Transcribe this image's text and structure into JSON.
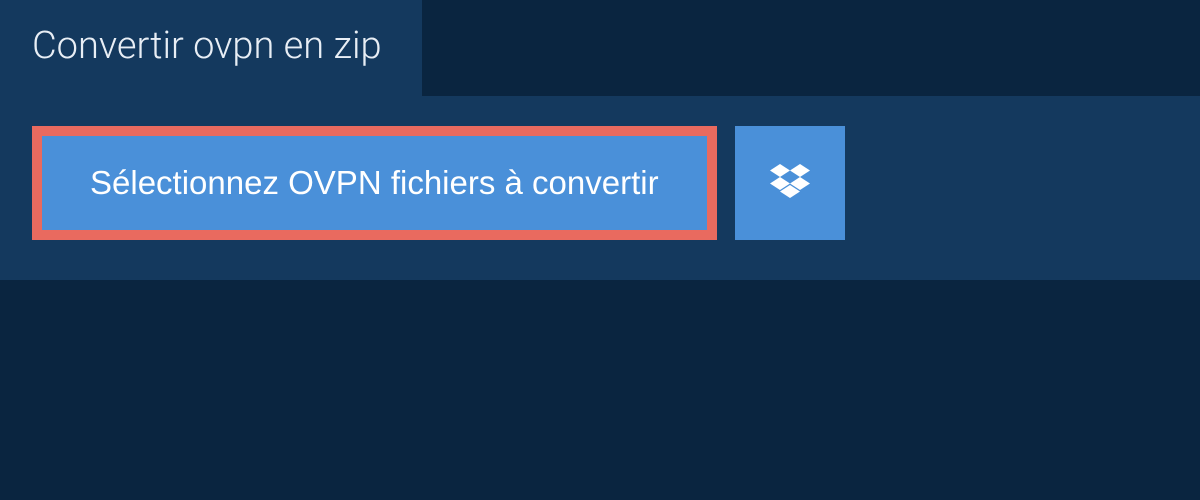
{
  "tab": {
    "title": "Convertir ovpn en zip"
  },
  "buttons": {
    "select_files_label": "Sélectionnez OVPN fichiers à convertir"
  },
  "colors": {
    "background": "#0a2540",
    "panel": "#14395e",
    "button": "#4a90d9",
    "highlight_border": "#e96a5f"
  }
}
